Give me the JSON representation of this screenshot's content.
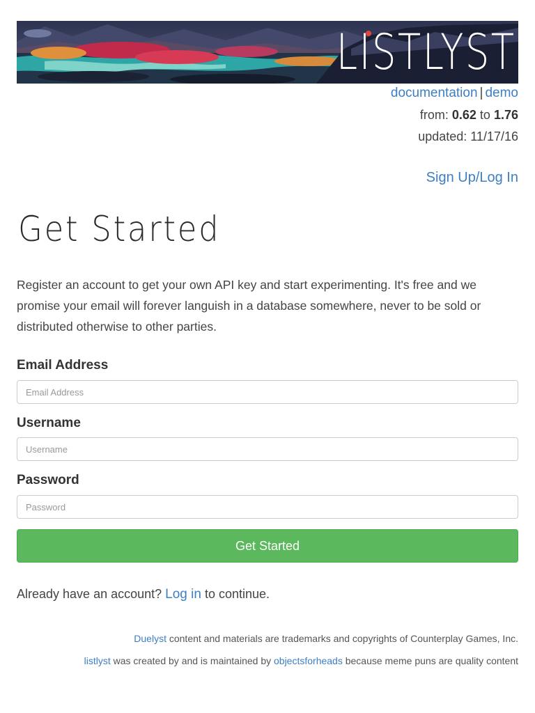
{
  "header": {
    "logo_text": "LISTLYST",
    "links": {
      "documentation": "documentation",
      "separator": "|",
      "demo": "demo"
    },
    "version": {
      "from_label": "from:",
      "from_value": "0.62",
      "to_label": "to",
      "to_value": "1.76"
    },
    "updated": "updated: 11/17/16",
    "signup_login": "Sign Up/Log In"
  },
  "main": {
    "title": "Get Started",
    "intro": "Register an account to get your own API key and start experimenting. It's free and we promise your email will forever languish in a database somewhere, never to be sold or distributed otherwise to other parties.",
    "form": {
      "email": {
        "label": "Email Address",
        "placeholder": "Email Address",
        "value": ""
      },
      "username": {
        "label": "Username",
        "placeholder": "Username",
        "value": ""
      },
      "password": {
        "label": "Password",
        "placeholder": "Password",
        "value": ""
      },
      "submit_label": "Get Started"
    },
    "already": {
      "prefix": "Already have an account?",
      "link": "Log in",
      "suffix": "to continue."
    }
  },
  "footer": {
    "line1": {
      "link": "Duelyst",
      "text": "content and materials are trademarks and copyrights of Counterplay Games, Inc."
    },
    "line2": {
      "link1": "listlyst",
      "text1": "was created by and is maintained by",
      "link2": "objectsforheads",
      "text2": "because meme puns are quality content"
    }
  },
  "colors": {
    "link": "#3c7fc3",
    "button": "#5cb85c",
    "text": "#333333"
  }
}
